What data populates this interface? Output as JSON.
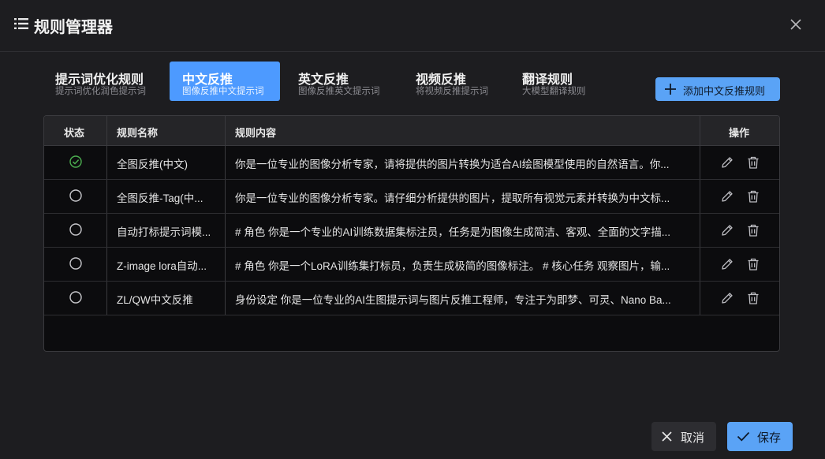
{
  "dialog": {
    "title": "规则管理器"
  },
  "tabs": [
    {
      "label": "提示词优化规则",
      "sub": "提示词优化润色提示词",
      "active": false
    },
    {
      "label": "中文反推",
      "sub": "图像反推中文提示词",
      "active": true
    },
    {
      "label": "英文反推",
      "sub": "图像反推英文提示词",
      "active": false
    },
    {
      "label": "视频反推",
      "sub": "将视频反推提示词",
      "active": false
    },
    {
      "label": "翻译规则",
      "sub": "大模型翻译规则",
      "active": false
    }
  ],
  "add_button": {
    "label": "添加中文反推规则"
  },
  "table": {
    "columns": [
      "状态",
      "规则名称",
      "规则内容",
      "操作"
    ],
    "rows": [
      {
        "active": true,
        "name": "全图反推(中文)",
        "content": "你是一位专业的图像分析专家，请将提供的图片转换为适合AI绘图模型使用的自然语言。你..."
      },
      {
        "active": false,
        "name": "全图反推-Tag(中...",
        "content": "你是一位专业的图像分析专家。请仔细分析提供的图片，提取所有视觉元素并转换为中文标..."
      },
      {
        "active": false,
        "name": "自动打标提示词模...",
        "content": "# 角色 你是一个专业的AI训练数据集标注员，任务是为图像生成简洁、客观、全面的文字描..."
      },
      {
        "active": false,
        "name": "Z-image lora自动...",
        "content": "# 角色 你是一个LoRA训练集打标员，负责生成极简的图像标注。 # 核心任务 观察图片，输..."
      },
      {
        "active": false,
        "name": "ZL/QW中文反推",
        "content": "身份设定 你是一位专业的AI生图提示词与图片反推工程师，专注于为即梦、可灵、Nano Ba..."
      }
    ]
  },
  "footer": {
    "cancel_label": "取消",
    "save_label": "保存"
  },
  "colors": {
    "accent": "#5aa3f6",
    "active_tab": "#4d9aff",
    "status_on": "#4caf50"
  },
  "icons": {
    "menu": "list-icon",
    "close": "close-icon",
    "add": "plus-icon",
    "edit": "edit-icon",
    "delete": "trash-icon",
    "cancel": "x-icon",
    "save": "check-icon"
  }
}
